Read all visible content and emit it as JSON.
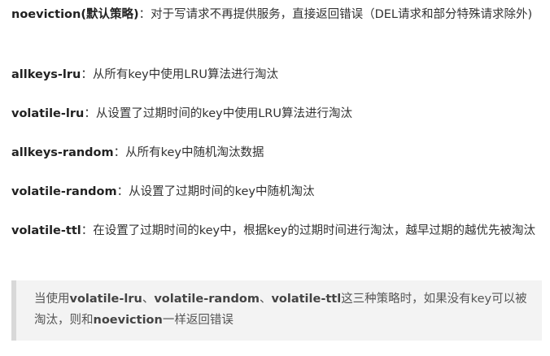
{
  "policies": [
    {
      "name": "noeviction(默认策略)",
      "description": "：对于写请求不再提供服务，直接返回错误（DEL请求和部分特殊请求除外)"
    },
    {
      "name": "allkeys-lru",
      "description": "：从所有key中使用LRU算法进行淘汰"
    },
    {
      "name": "volatile-lru",
      "description": "：从设置了过期时间的key中使用LRU算法进行淘汰"
    },
    {
      "name": "allkeys-random",
      "description": "：从所有key中随机淘汰数据"
    },
    {
      "name": "volatile-random",
      "description": "：从设置了过期时间的key中随机淘汰"
    },
    {
      "name": "volatile-ttl",
      "description": "：在设置了过期时间的key中，根据key的过期时间进行淘汰，越早过期的越优先被淘汰"
    }
  ],
  "note": {
    "prefix": "当使用",
    "term1": "volatile-lru",
    "sep1": "、",
    "term2": "volatile-random",
    "sep2": "、",
    "term3": "volatile-ttl",
    "middle": "这三种策略时，如果没有key可以被淘汰，则和",
    "term4": "noeviction",
    "suffix": "一样返回错误"
  }
}
